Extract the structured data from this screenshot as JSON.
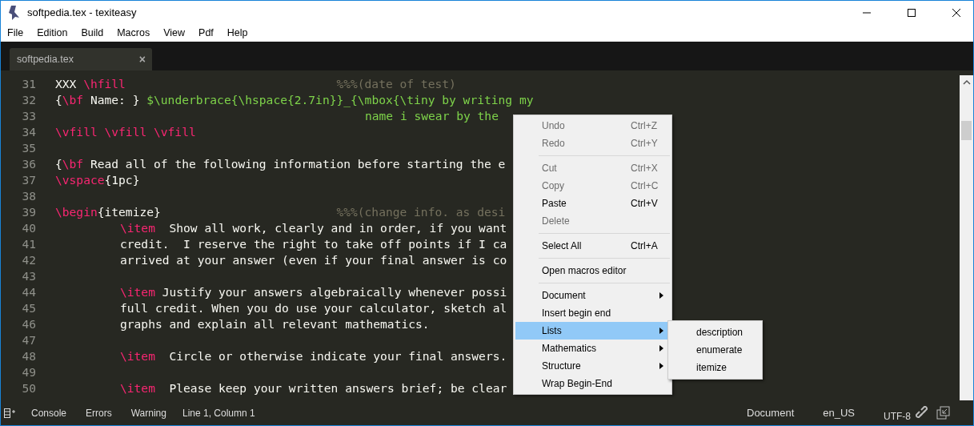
{
  "window": {
    "title": "softpedia.tex - texiteasy"
  },
  "menubar": [
    "File",
    "Edition",
    "Build",
    "Macros",
    "View",
    "Pdf",
    "Help"
  ],
  "tabs": [
    {
      "label": "softpedia.tex",
      "selected": true,
      "close": "×"
    }
  ],
  "editor": {
    "lines": [
      {
        "number": "31",
        "kind": "plain",
        "tokens": [
          {
            "kind": "text",
            "text": "XXX "
          },
          {
            "kind": "command",
            "text": "\\hfill"
          },
          {
            "kind": "comment",
            "text": "%%%(date of test)"
          }
        ]
      },
      {
        "number": "32",
        "kind": "plain",
        "tokens": [
          {
            "kind": "text",
            "text": "{"
          },
          {
            "kind": "command",
            "text": "\\bf"
          },
          {
            "kind": "text",
            "text": " Name: } "
          },
          {
            "kind": "math",
            "text": "$\\underbrace{\\hspace{2.7in}}_{\\mbox{\\tiny by writing my"
          }
        ]
      },
      {
        "number": "33",
        "kind": "continuation",
        "tokens": [
          {
            "kind": "math",
            "text": "name i swear by the"
          }
        ]
      },
      {
        "number": "34",
        "kind": "plain",
        "tokens": [
          {
            "kind": "command",
            "text": "\\vfill \\vfill \\vfill"
          }
        ]
      },
      {
        "number": "35"
      },
      {
        "number": "36",
        "kind": "plain",
        "tokens": [
          {
            "kind": "text",
            "text": "{"
          },
          {
            "kind": "command",
            "text": "\\bf"
          },
          {
            "kind": "text",
            "text": " Read all of the following information before starting the e"
          }
        ]
      },
      {
        "number": "37",
        "kind": "plain",
        "tokens": [
          {
            "kind": "command",
            "text": "\\vspace"
          },
          {
            "kind": "text",
            "text": "{1pc}"
          }
        ]
      },
      {
        "number": "38"
      },
      {
        "number": "39",
        "kind": "plain",
        "tokens": [
          {
            "kind": "command",
            "text": "\\begin"
          },
          {
            "kind": "text",
            "text": "{itemize}"
          },
          {
            "kind": "comment",
            "text": "%%%(change info. as desi"
          }
        ]
      },
      {
        "number": "40",
        "kind": "indented",
        "tokens": [
          {
            "kind": "command",
            "text": "\\item"
          },
          {
            "kind": "text",
            "text": "  Show all work, clearly and in order, if you want"
          }
        ]
      },
      {
        "number": "41",
        "kind": "indented",
        "tokens": [
          {
            "kind": "text",
            "text": "credit.  I reserve the right to take off points if I ca"
          }
        ]
      },
      {
        "number": "42",
        "kind": "indented",
        "tokens": [
          {
            "kind": "text",
            "text": "arrived at your answer (even if your final answer is co"
          }
        ]
      },
      {
        "number": "43"
      },
      {
        "number": "44",
        "kind": "indented",
        "tokens": [
          {
            "kind": "command",
            "text": "\\item"
          },
          {
            "kind": "text",
            "text": " Justify your answers algebraically whenever possi"
          }
        ]
      },
      {
        "number": "45",
        "kind": "indented",
        "tokens": [
          {
            "kind": "text",
            "text": "full credit. When you do use your calculator, sketch al"
          }
        ]
      },
      {
        "number": "46",
        "kind": "indented",
        "tokens": [
          {
            "kind": "text",
            "text": "graphs and explain all relevant mathematics."
          }
        ]
      },
      {
        "number": "47"
      },
      {
        "number": "48",
        "kind": "indented",
        "tokens": [
          {
            "kind": "command",
            "text": "\\item"
          },
          {
            "kind": "text",
            "text": "  Circle or otherwise indicate your final answers."
          }
        ]
      },
      {
        "number": "49"
      },
      {
        "number": "50",
        "kind": "indented",
        "tokens": [
          {
            "kind": "command",
            "text": "\\item"
          },
          {
            "kind": "text",
            "text": "  Please keep your written answers brief; be clear"
          }
        ]
      }
    ]
  },
  "context_menu": {
    "items": [
      {
        "kind": "item",
        "label": "Undo",
        "shortcut": "Ctrl+Z",
        "disabled": true,
        "selected": false
      },
      {
        "kind": "item",
        "label": "Redo",
        "shortcut": "Ctrl+Y",
        "disabled": true,
        "selected": false
      },
      {
        "kind": "separator"
      },
      {
        "kind": "item",
        "label": "Cut",
        "shortcut": "Ctrl+X",
        "disabled": true,
        "selected": false
      },
      {
        "kind": "item",
        "label": "Copy",
        "shortcut": "Ctrl+C",
        "disabled": true,
        "selected": false
      },
      {
        "kind": "item",
        "label": "Paste",
        "shortcut": "Ctrl+V",
        "disabled": false,
        "selected": false
      },
      {
        "kind": "item",
        "label": "Delete",
        "disabled": true,
        "selected": false
      },
      {
        "kind": "separator"
      },
      {
        "kind": "item",
        "label": "Select All",
        "shortcut": "Ctrl+A",
        "disabled": false,
        "selected": false
      },
      {
        "kind": "separator"
      },
      {
        "kind": "item",
        "label": "Open macros editor",
        "disabled": false,
        "selected": false
      },
      {
        "kind": "separator"
      },
      {
        "kind": "submenu",
        "label": "Document",
        "disabled": false,
        "selected": false
      },
      {
        "kind": "item",
        "label": "Insert begin end",
        "disabled": false,
        "selected": false
      },
      {
        "kind": "submenu",
        "label": "Lists",
        "disabled": false,
        "selected": true
      },
      {
        "kind": "submenu",
        "label": "Mathematics",
        "disabled": false,
        "selected": false
      },
      {
        "kind": "submenu",
        "label": "Structure",
        "disabled": false,
        "selected": false
      },
      {
        "kind": "item",
        "label": "Wrap Begin-End",
        "disabled": false,
        "selected": false
      }
    ],
    "submenu": [
      "description",
      "enumerate",
      "itemize"
    ]
  },
  "status_bar": {
    "panels": [
      "Console",
      "Errors",
      "Warning"
    ],
    "position": "Line 1, Column 1",
    "document": "Document",
    "language": "en_US",
    "encoding": "UTF-8"
  }
}
